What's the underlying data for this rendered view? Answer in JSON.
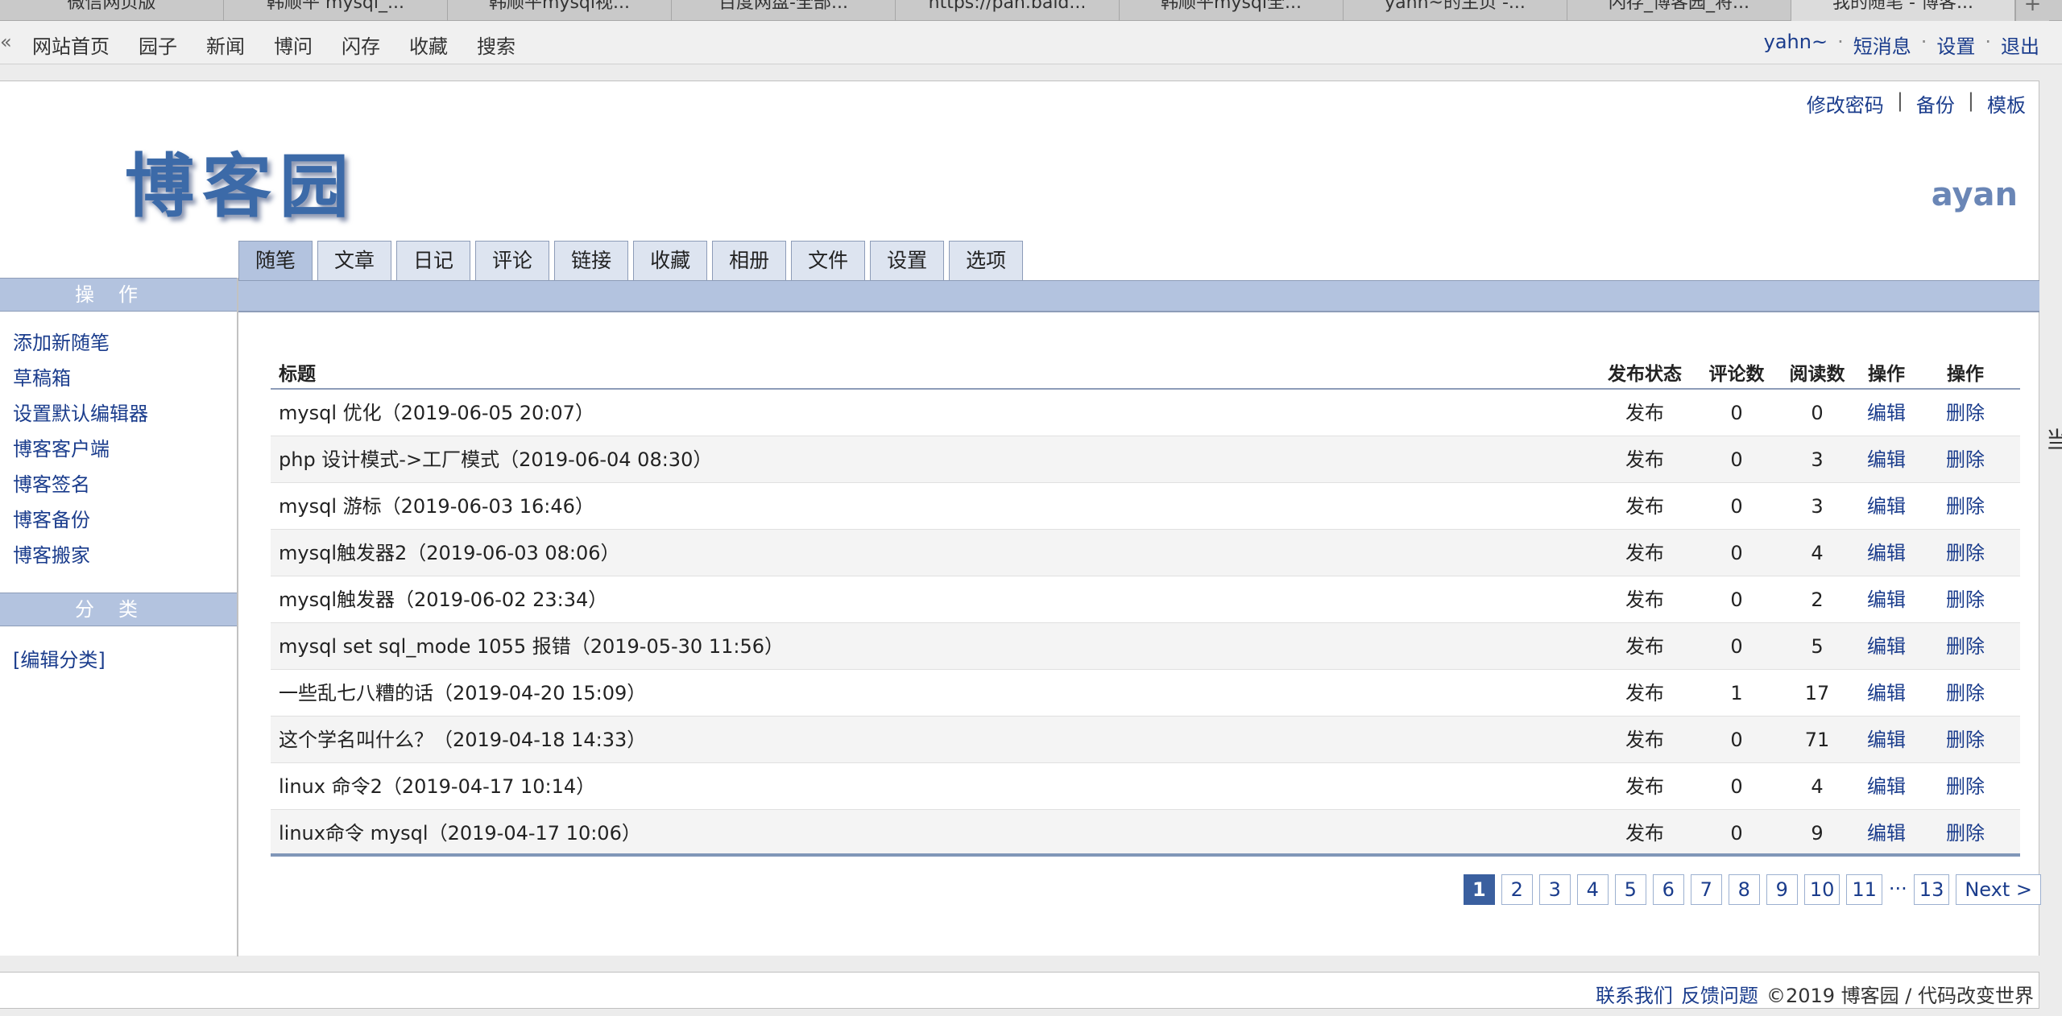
{
  "browser_tabs": [
    {
      "label": "微信网页版"
    },
    {
      "label": "韩顺平 mysql_..."
    },
    {
      "label": "韩顺平mysql视..."
    },
    {
      "label": "百度网盘-全部..."
    },
    {
      "label": "https://pan.baid..."
    },
    {
      "label": "韩顺平mysql全..."
    },
    {
      "label": "yahn~的主页 -..."
    },
    {
      "label": "闪存_博客园_将..."
    },
    {
      "label": "我的随笔 - 博客..."
    }
  ],
  "new_tab_symbol": "+",
  "topnav": {
    "back_symbol": "«",
    "links": [
      "网站首页",
      "园子",
      "新闻",
      "博问",
      "闪存",
      "收藏",
      "搜索"
    ],
    "user": {
      "name": "yahn~",
      "messages": "短消息",
      "settings": "设置",
      "logout": "退出",
      "separator": "·"
    }
  },
  "header": {
    "links": {
      "change_password": "修改密码",
      "backup": "备份",
      "template": "模板",
      "separator": "|"
    },
    "logo_text": "博客园",
    "blog_name": "ayan"
  },
  "tabs": [
    "随笔",
    "文章",
    "日记",
    "评论",
    "链接",
    "收藏",
    "相册",
    "文件",
    "设置",
    "选项"
  ],
  "sidebar": {
    "actions_title": "操作",
    "actions": [
      "添加新随笔",
      "草稿箱",
      "设置默认编辑器",
      "博客客户端",
      "博客签名",
      "博客备份",
      "博客搬家"
    ],
    "category_title": "分类",
    "edit_category": "[编辑分类]"
  },
  "table": {
    "headers": {
      "title": "标题",
      "status": "发布状态",
      "comments": "评论数",
      "views": "阅读数",
      "edit": "操作",
      "delete": "操作"
    },
    "rows": [
      {
        "title": "mysql 优化（2019-06-05 20:07）",
        "status": "发布",
        "comments": "0",
        "views": "0",
        "edit": "编辑",
        "delete": "删除"
      },
      {
        "title": "php 设计模式->工厂模式（2019-06-04 08:30）",
        "status": "发布",
        "comments": "0",
        "views": "3",
        "edit": "编辑",
        "delete": "删除"
      },
      {
        "title": "mysql 游标（2019-06-03 16:46）",
        "status": "发布",
        "comments": "0",
        "views": "3",
        "edit": "编辑",
        "delete": "删除"
      },
      {
        "title": "mysql触发器2（2019-06-03 08:06）",
        "status": "发布",
        "comments": "0",
        "views": "4",
        "edit": "编辑",
        "delete": "删除"
      },
      {
        "title": "mysql触发器（2019-06-02 23:34）",
        "status": "发布",
        "comments": "0",
        "views": "2",
        "edit": "编辑",
        "delete": "删除"
      },
      {
        "title": "mysql set sql_mode 1055 报错（2019-05-30 11:56）",
        "status": "发布",
        "comments": "0",
        "views": "5",
        "edit": "编辑",
        "delete": "删除"
      },
      {
        "title": "一些乱七八糟的话（2019-04-20 15:09）",
        "status": "发布",
        "comments": "1",
        "views": "17",
        "edit": "编辑",
        "delete": "删除"
      },
      {
        "title": "这个学名叫什么？（2019-04-18 14:33）",
        "status": "发布",
        "comments": "0",
        "views": "71",
        "edit": "编辑",
        "delete": "删除"
      },
      {
        "title": "linux 命令2（2019-04-17 10:14）",
        "status": "发布",
        "comments": "0",
        "views": "4",
        "edit": "编辑",
        "delete": "删除"
      },
      {
        "title": "linux命令 mysql（2019-04-17 10:06）",
        "status": "发布",
        "comments": "0",
        "views": "9",
        "edit": "编辑",
        "delete": "删除"
      }
    ]
  },
  "pager": {
    "pages": [
      "1",
      "2",
      "3",
      "4",
      "5",
      "6",
      "7",
      "8",
      "9",
      "10",
      "11"
    ],
    "ellipsis": "···",
    "last_page": "13",
    "next": "Next >",
    "current": "1"
  },
  "footer": {
    "contact": "联系我们",
    "feedback": "反馈问题",
    "copyright": "©2019 博客园 / 代码改变世界"
  },
  "right_edge_glyph": "当",
  "colors": {
    "link": "#1a3c8c",
    "tab_bar": "#b3c3df",
    "tab_idle": "#dde4f0",
    "pager_active": "#3a5f9f"
  }
}
